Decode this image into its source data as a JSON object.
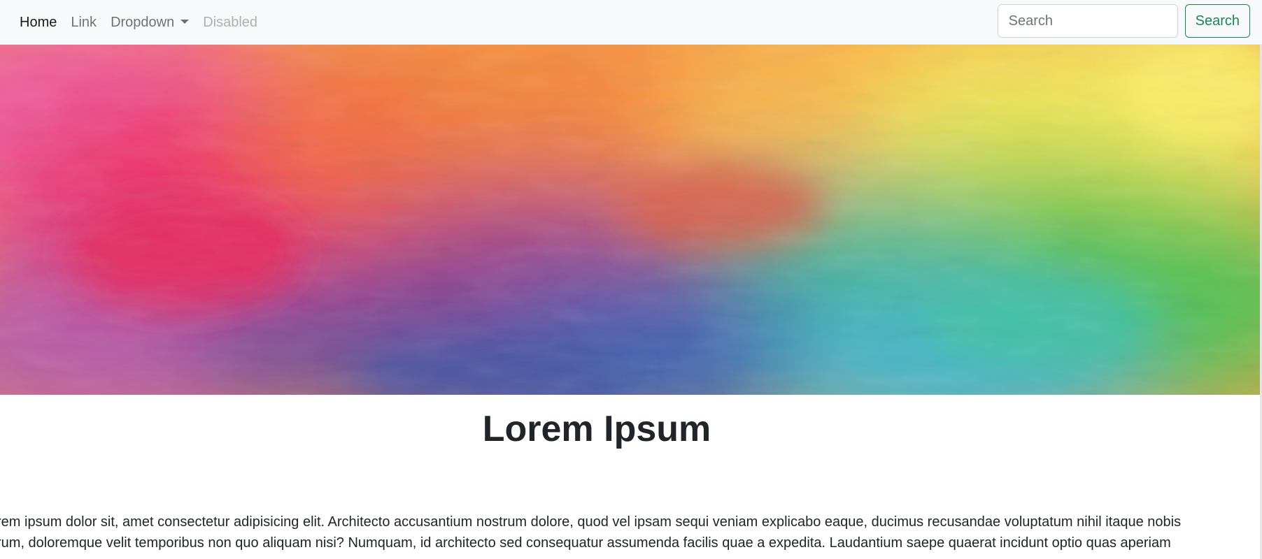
{
  "navbar": {
    "links": [
      {
        "label": "Home",
        "state": "active"
      },
      {
        "label": "Link",
        "state": "normal"
      },
      {
        "label": "Dropdown",
        "state": "dropdown"
      },
      {
        "label": "Disabled",
        "state": "disabled"
      }
    ],
    "search": {
      "placeholder": "Search",
      "value": "",
      "button_label": "Search"
    }
  },
  "hero": {
    "image": "watercolor-rainbow-banner",
    "colors": [
      "#ec4a80",
      "#f46a3a",
      "#f9a23c",
      "#f7e85a",
      "#6cc35a",
      "#3ea0c8",
      "#3b4fa8",
      "#8b4f9e"
    ]
  },
  "main": {
    "title": "Lorem Ipsum",
    "paragraph_lines": [
      "rem ipsum dolor sit, amet consectetur adipisicing elit. Architecto accusantium nostrum dolore, quod vel ipsam sequi veniam explicabo eaque, ducimus recusandae voluptatum nihil itaque nobis",
      "rum, doloremque velit temporibus non quo aliquam nisi? Numquam, id architecto sed consequatur assumenda facilis quae a expedita. Laudantium saepe quaerat incidunt optio quas aperiam"
    ]
  },
  "colors": {
    "navbar_bg": "#f8f9fa",
    "success": "#198754",
    "text": "#212529"
  }
}
